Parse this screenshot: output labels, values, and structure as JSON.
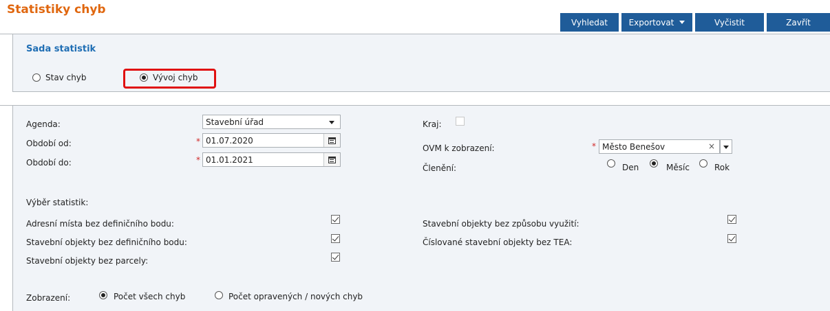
{
  "header": {
    "title": "Statistiky chyb"
  },
  "toolbar": {
    "search_label": "Vyhledat",
    "export_label": "Exportovat",
    "clear_label": "Vyčistit",
    "close_label": "Zavřít"
  },
  "statistics_set": {
    "title": "Sada statistik",
    "options": [
      {
        "label": "Stav chyb",
        "selected": false
      },
      {
        "label": "Vývoj chyb",
        "selected": true
      }
    ]
  },
  "filters": {
    "agenda": {
      "label": "Agenda:",
      "value": "Stavební úřad"
    },
    "period_from": {
      "label": "Období od:",
      "value": "01.07.2020"
    },
    "period_to": {
      "label": "Období do:",
      "value": "01.01.2021"
    },
    "region": {
      "label": "Kraj:",
      "checked": false
    },
    "ovm": {
      "label": "OVM k zobrazení:",
      "value": "Město Benešov"
    },
    "breakdown": {
      "label": "Členění:",
      "options": [
        {
          "label": "Den",
          "selected": false
        },
        {
          "label": "Měsíc",
          "selected": true
        },
        {
          "label": "Rok",
          "selected": false
        }
      ]
    }
  },
  "stats_selection": {
    "title": "Výběr statistik:",
    "left": [
      {
        "label": "Adresní místa bez definičního bodu:",
        "checked": true
      },
      {
        "label": "Stavební objekty bez definičního bodu:",
        "checked": true
      },
      {
        "label": "Stavební objekty bez parcely:",
        "checked": true
      }
    ],
    "right": [
      {
        "label": "Stavební objekty bez způsobu využití:",
        "checked": true
      },
      {
        "label": "Číslované stavební objekty bez TEA:",
        "checked": true
      }
    ]
  },
  "display": {
    "label": "Zobrazení:",
    "options": [
      {
        "label": "Počet všech chyb",
        "selected": true
      },
      {
        "label": "Počet opravených / nových chyb",
        "selected": false
      }
    ]
  },
  "required_mark": "*",
  "colors": {
    "title": "#e0670f",
    "button": "#1f5c99",
    "section": "#1f6eb4",
    "highlight": "#e01010"
  }
}
